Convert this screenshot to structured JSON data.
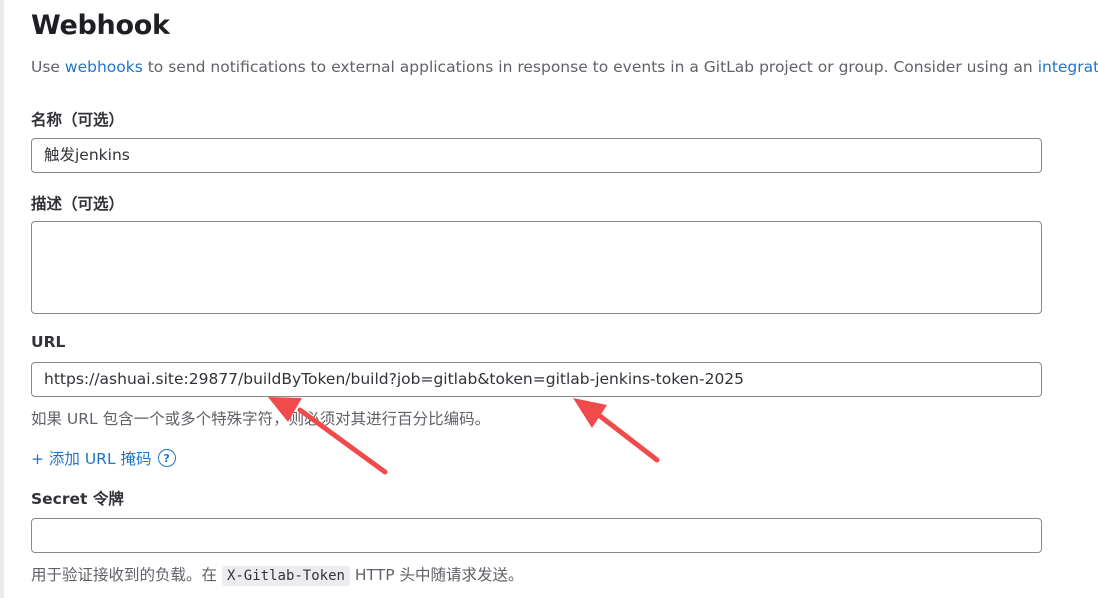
{
  "page": {
    "title": "Webhook",
    "intro_prefix": "Use ",
    "intro_link": "webhooks",
    "intro_suffix": " to send notifications to external applications in response to events in a GitLab project or group. Consider using an ",
    "intro_link2": "integration"
  },
  "form": {
    "name_label": "名称（可选）",
    "name_value": "触发jenkins",
    "description_label": "描述（可选）",
    "description_value": "",
    "url_label": "URL",
    "url_value": "https://ashuai.site:29877/buildByToken/build?job=gitlab&token=gitlab-jenkins-token-2025",
    "url_help": "如果 URL 包含一个或多个特殊字符，则必须对其进行百分比编码。",
    "add_mask_label": "+ 添加 URL 掩码",
    "add_mask_help_glyph": "?",
    "secret_label": "Secret 令牌",
    "secret_value": "",
    "secret_help_prefix": "用于验证接收到的负载。在 ",
    "secret_help_code": "X-Gitlab-Token",
    "secret_help_suffix": " HTTP 头中随请求发送。"
  },
  "annotations": {
    "arrow_color": "#f04a4a"
  }
}
